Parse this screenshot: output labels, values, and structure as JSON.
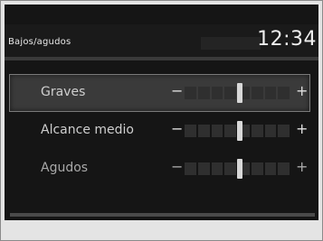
{
  "header": {
    "title": "Bajos/agudos",
    "clock": "12:34"
  },
  "settings": [
    {
      "label": "Graves",
      "minus": "−",
      "plus": "+",
      "value_fraction": 0.5,
      "selected": true
    },
    {
      "label": "Alcance medio",
      "minus": "−",
      "plus": "+",
      "value_fraction": 0.5,
      "selected": false
    },
    {
      "label": "Agudos",
      "minus": "−",
      "plus": "+",
      "value_fraction": 0.5,
      "selected": false
    }
  ],
  "colors": {
    "screen_background": "#151515",
    "highlight_row": "#3a3a3a",
    "text": "#cfcfcf"
  }
}
